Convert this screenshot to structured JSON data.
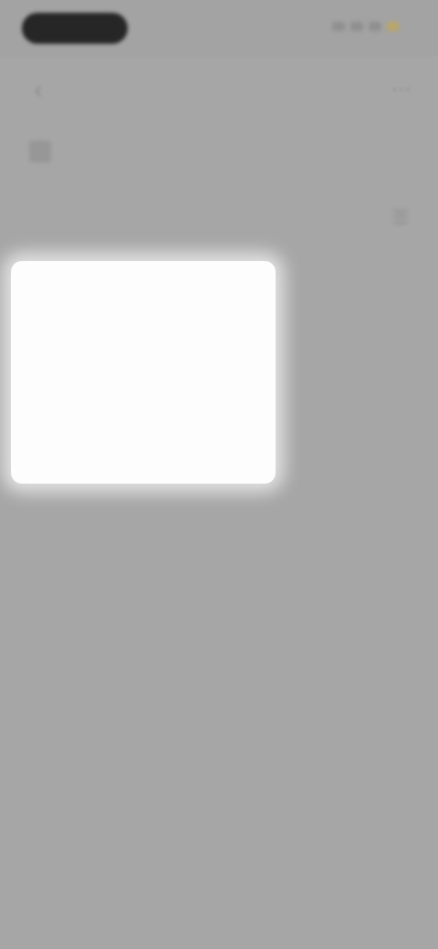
{
  "status_bar": {
    "time": "",
    "indicator_colors": [
      "#8f8f8f",
      "#8f8f8f",
      "#8f8f8f",
      "#b9a66a"
    ]
  },
  "nav": {
    "back_icon": "back-arrow-icon",
    "title": "",
    "action_icon": "more-icon"
  },
  "sub_header": {
    "icon": "menu-icon",
    "label": ""
  },
  "filters": {
    "chips": [
      "",
      "",
      ""
    ],
    "icon": "filter-icon",
    "accent_color": "#b69a5d"
  },
  "dropdown": {
    "items": [
      "",
      "",
      "",
      ""
    ]
  },
  "colors": {
    "overlay": "#a6a6a6",
    "dropdown_bg": "#fdfdfd"
  }
}
